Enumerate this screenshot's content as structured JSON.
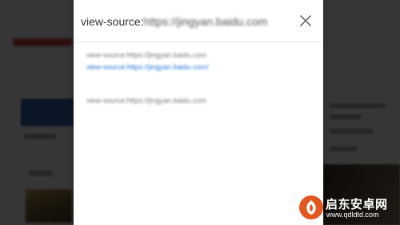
{
  "dialog": {
    "title_prefix": "view-source:",
    "title_host": "https://jingyan.baidu.com",
    "close_icon": "close-icon",
    "lines": [
      "view-source:https://jingyan.baidu.com",
      "view-source:https://jingyan.baidu.com/",
      "view-source:https://jingyan.baidu.com"
    ]
  },
  "watermark": {
    "name": "启东安卓网",
    "url": "www.qdldtd.com",
    "logo_icon": "brand-logo-icon",
    "logo_color": "#e2561f"
  },
  "colors": {
    "overlay": "#000000",
    "link": "#2a78d6",
    "text": "#333333"
  }
}
